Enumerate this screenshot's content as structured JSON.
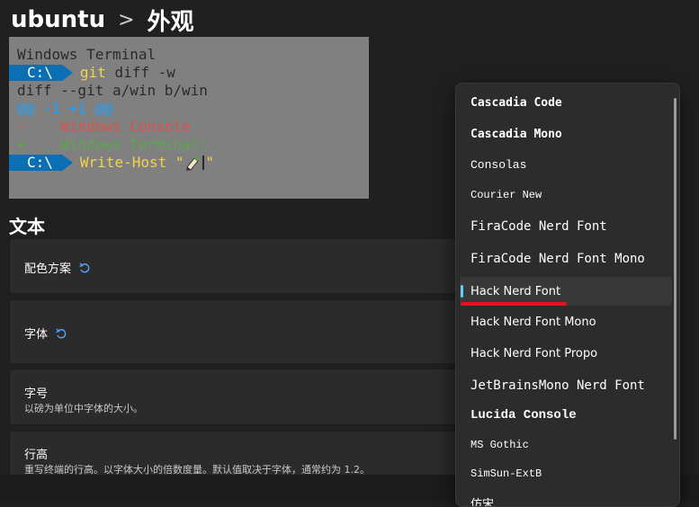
{
  "header": {
    "profile": "ubuntu",
    "separator": ">",
    "title": "外观"
  },
  "preview": {
    "line1": "Windows Terminal",
    "prompt": "C:\\",
    "cmd1": "git",
    "cmd1_args": " diff -w",
    "line3": "diff --git a/win b/win",
    "line4": "@@ -1 +1 @@",
    "line5": "-    Windows Console",
    "line6": "+    Windows Terminal!",
    "cmd2": "Write-Host",
    "cmd2_str_open": " \"",
    "cmd2_str_close": "\""
  },
  "section": {
    "title": "文本"
  },
  "settings": {
    "color_scheme": {
      "label": "配色方案"
    },
    "font": {
      "label": "字体"
    },
    "font_size": {
      "label": "字号",
      "desc": "以磅为单位中字体的大小。"
    },
    "line_height": {
      "label": "行高",
      "desc": "重写终端的行高。以字体大小的倍数度量。默认值取决于字体，通常约为 1.2。"
    }
  },
  "font_list": {
    "items": [
      "Cascadia Code",
      "Cascadia Mono",
      "Consolas",
      "Courier New",
      "FiraCode Nerd Font",
      "FiraCode Nerd Font Mono",
      "Hack Nerd Font",
      "Hack Nerd Font Mono",
      "Hack Nerd Font Propo",
      "JetBrainsMono Nerd Font",
      "Lucida Console",
      "MS Gothic",
      "SimSun-ExtB",
      "仿宋"
    ],
    "selected": "Hack Nerd Font"
  },
  "colors": {
    "accent": "#60cdff",
    "annotation": "#e81123",
    "prompt_bg": "#0b6fb3"
  }
}
